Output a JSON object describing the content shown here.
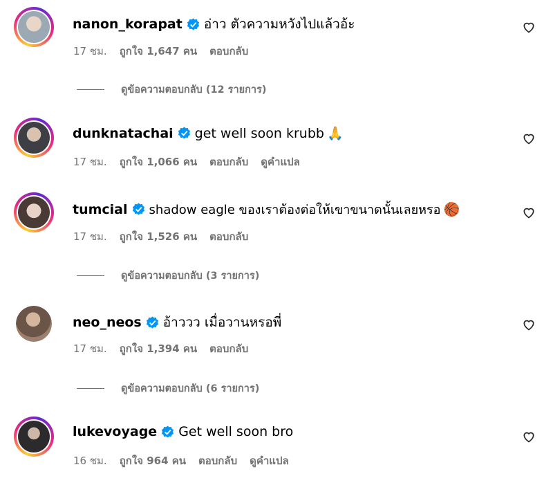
{
  "comments": [
    {
      "username": "nanon_korapat",
      "text": "อ่าว ตัวความหวังไปแล้วอ้ะ",
      "time": "17 ชม.",
      "likes": "ถูกใจ 1,647 คน",
      "reply": "ตอบกลับ",
      "translate": "",
      "view_replies": "ดูข้อความตอบกลับ (12 รายการ)",
      "avatar_color": "#b7c3cc"
    },
    {
      "username": "dunknatachai",
      "text": "get well soon krubb",
      "emoji": "🙏",
      "time": "17 ชม.",
      "likes": "ถูกใจ 1,066 คน",
      "reply": "ตอบกลับ",
      "translate": "ดูคำแปล",
      "view_replies": "",
      "avatar_color": "#3d3f45"
    },
    {
      "username": "tumcial",
      "text": "shadow eagle ของเราต้องต่อให้เขาขนาดนั้นเลยหรอ",
      "emoji": "🏀",
      "time": "17 ชม.",
      "likes": "ถูกใจ 1,526 คน",
      "reply": "ตอบกลับ",
      "translate": "",
      "view_replies": "ดูข้อความตอบกลับ (3 รายการ)",
      "avatar_color": "#c9b8b0"
    },
    {
      "username": "neo_neos",
      "text": "อ้าววว เมื่อวานหรอพี่",
      "time": "17 ชม.",
      "likes": "ถูกใจ 1,394 คน",
      "reply": "ตอบกลับ",
      "translate": "",
      "view_replies": "ดูข้อความตอบกลับ (6 รายการ)",
      "avatar_color": "#7d6a5e"
    },
    {
      "username": "lukevoyage",
      "text": "Get well soon bro",
      "time": "16 ชม.",
      "likes": "ถูกใจ 964 คน",
      "reply": "ตอบกลับ",
      "translate": "ดูคำแปล",
      "view_replies": "",
      "avatar_color": "#2b2b2e"
    }
  ],
  "colors": {
    "verified": "#0095f6",
    "secondary_text": "#737373",
    "ring": "#ee2a7b"
  }
}
